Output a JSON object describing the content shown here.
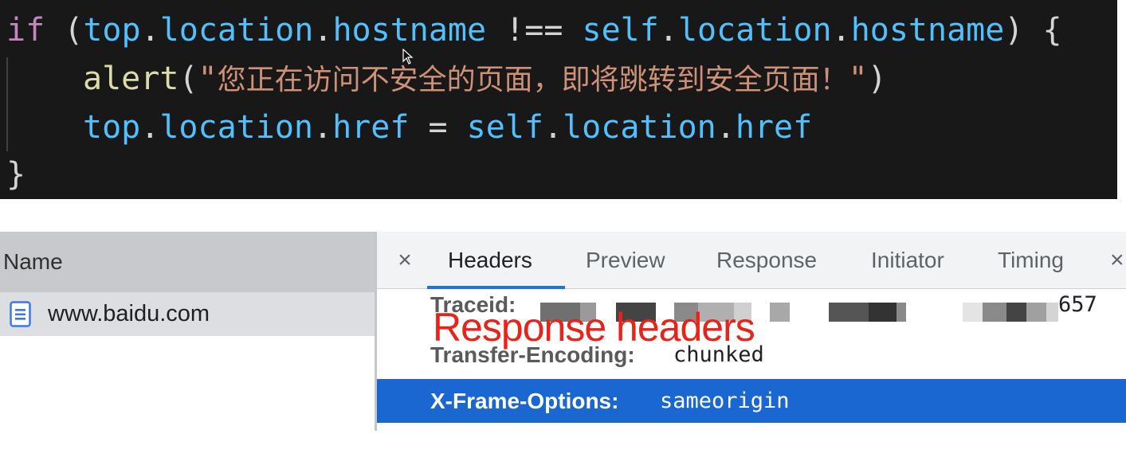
{
  "code": {
    "line1": {
      "kw": "if",
      "open": " (",
      "a1": "top",
      "d1": ".",
      "a2": "location",
      "d2": ".",
      "a3": "hostname",
      "op": " !== ",
      "b1": "self",
      "d3": ".",
      "b2": "location",
      "d4": ".",
      "b3": "hostname",
      "close": ") {"
    },
    "line2": {
      "fn": "alert",
      "open": "(",
      "str_q1": "\"",
      "str_text": "您正在访问不安全的页面，即将跳转到安全页面！",
      "str_q2": "\"",
      "close": ")"
    },
    "line3": {
      "a1": "top",
      "d1": ".",
      "a2": "location",
      "d2": ".",
      "a3": "href",
      "op": " = ",
      "b1": "self",
      "d3": ".",
      "b2": "location",
      "d4": ".",
      "b3": "href"
    },
    "line4": "}"
  },
  "network": {
    "name_header": "Name",
    "requests": [
      {
        "name": "www.baidu.com",
        "icon": "document-icon"
      }
    ]
  },
  "details": {
    "close_glyph": "×",
    "tabs": [
      {
        "label": "Headers",
        "active": true
      },
      {
        "label": "Preview",
        "active": false
      },
      {
        "label": "Response",
        "active": false
      },
      {
        "label": "Initiator",
        "active": false
      },
      {
        "label": "Timing",
        "active": false
      }
    ],
    "overflow_glyph": "×",
    "overlay_title": "Response headers",
    "headers": [
      {
        "key": "Traceid:",
        "value_visible_tail": "657",
        "redacted": true
      },
      {
        "key": "Transfer-Encoding:",
        "value": "chunked"
      },
      {
        "key": "X-Frame-Options:",
        "value": "sameorigin",
        "selected": true
      }
    ]
  },
  "colors": {
    "code_bg": "#181818",
    "keyword": "#c586c0",
    "identifier": "#4fc1ff",
    "function": "#dcdcaa",
    "string": "#ce9178",
    "selected_row": "#1a67d2",
    "tab_underline": "#1a73e8",
    "overlay_text": "#e8231a"
  }
}
